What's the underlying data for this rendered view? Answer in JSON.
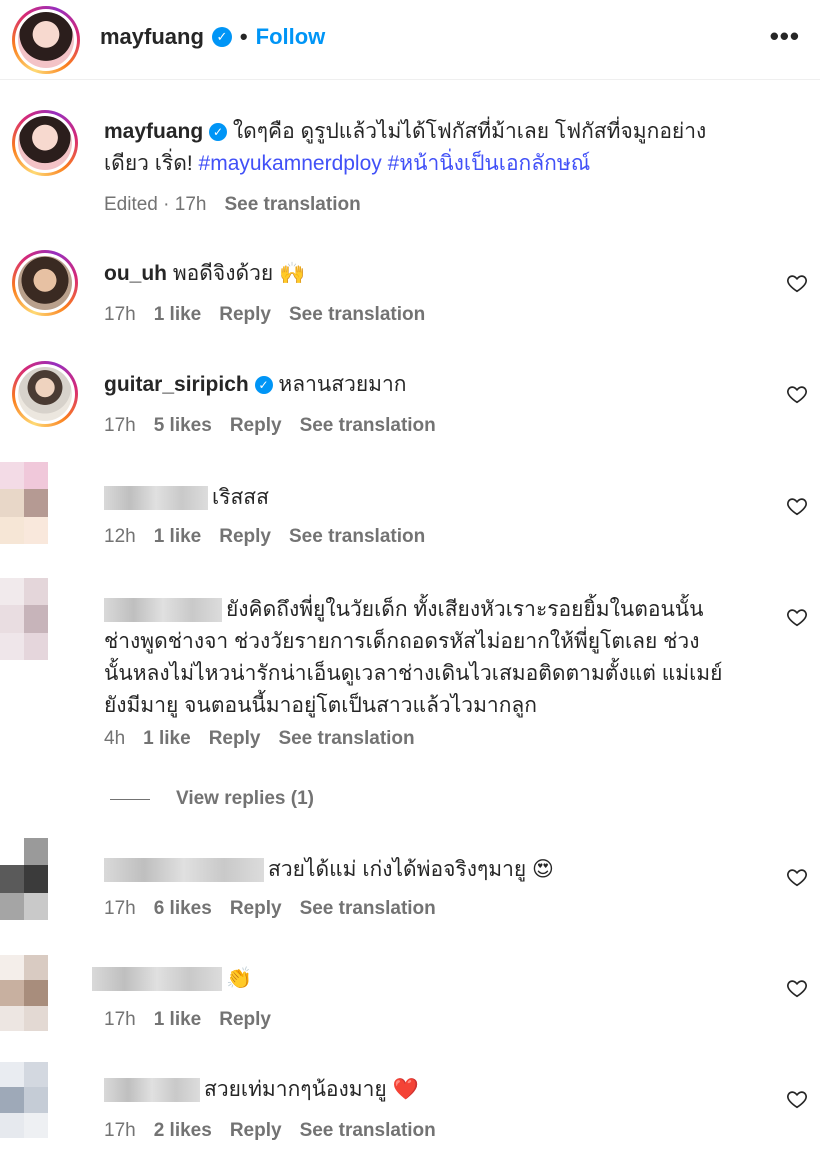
{
  "post_header": {
    "username": "mayfuang",
    "separator": "•",
    "follow_label": "Follow",
    "more_label": "•••"
  },
  "caption": {
    "username": "mayfuang",
    "text_line1": "ใดๆคือ ดูรูปแล้วไม่ได้โฟกัสที่ม้าเลย โฟกัสที่จมูกอย่าง",
    "text_line2_plain": "เดียว เริ่ด! ",
    "hashtag1": "#mayukamnerdploy",
    "hashtag2": "#หน้านิ่งเป็นเอกลักษณ์",
    "edited": "Edited · 17h",
    "see_translation": "See translation"
  },
  "comments": [
    {
      "username": "ou_uh",
      "text": "พอดีจิงด้วย 🙌",
      "time": "17h",
      "likes": "1 like",
      "reply": "Reply",
      "see_translation": "See translation"
    },
    {
      "username": "guitar_siripich",
      "text": "หลานสวยมาก",
      "time": "17h",
      "likes": "5 likes",
      "reply": "Reply",
      "see_translation": "See translation"
    },
    {
      "username": "",
      "text": "เริสสส",
      "time": "12h",
      "likes": "1 like",
      "reply": "Reply",
      "see_translation": "See translation"
    },
    {
      "username": "",
      "text_lines": [
        "ยังคิดถึงพี่ยูในวัยเด็ก ทั้งเสียงหัวเราะรอยยิ้มในตอนนั้น",
        "ช่างพูดช่างจา ช่วงวัยรายการเด็กถอดรหัสไม่อยากให้พี่ยูโตเลย ช่วง",
        "นั้นหลงไม่ไหวน่ารักน่าเอ็นดูเวลาช่างเดินไวเสมอติดตามตั้งแต่ แม่เมย์",
        "ยังมีมายู จนตอนนี้มาอยู่โตเป็นสาวแล้วไวมากลูก"
      ],
      "time": "4h",
      "likes": "1 like",
      "reply": "Reply",
      "see_translation": "See translation",
      "view_replies": "View replies (1)"
    },
    {
      "username": "",
      "text": "สวยได้แม่ เก่งได้พ่อจริงๆมายู 😍",
      "time": "17h",
      "likes": "6 likes",
      "reply": "Reply",
      "see_translation": "See translation"
    },
    {
      "username": "",
      "text": "👏",
      "time": "17h",
      "likes": "1 like",
      "reply": "Reply"
    },
    {
      "username": "",
      "text": "สวยเท่มากๆน้องมายู ❤️",
      "time": "17h",
      "likes": "2 likes",
      "reply": "Reply",
      "see_translation": "See translation"
    }
  ],
  "icons": {
    "verified": "verified-badge-icon",
    "heart": "heart-outline-icon",
    "more": "more-horizontal-icon"
  },
  "colors": {
    "accent_blue": "#0095f6",
    "hashtag": "#4150f7",
    "meta_gray": "#737373",
    "text": "#262626"
  }
}
